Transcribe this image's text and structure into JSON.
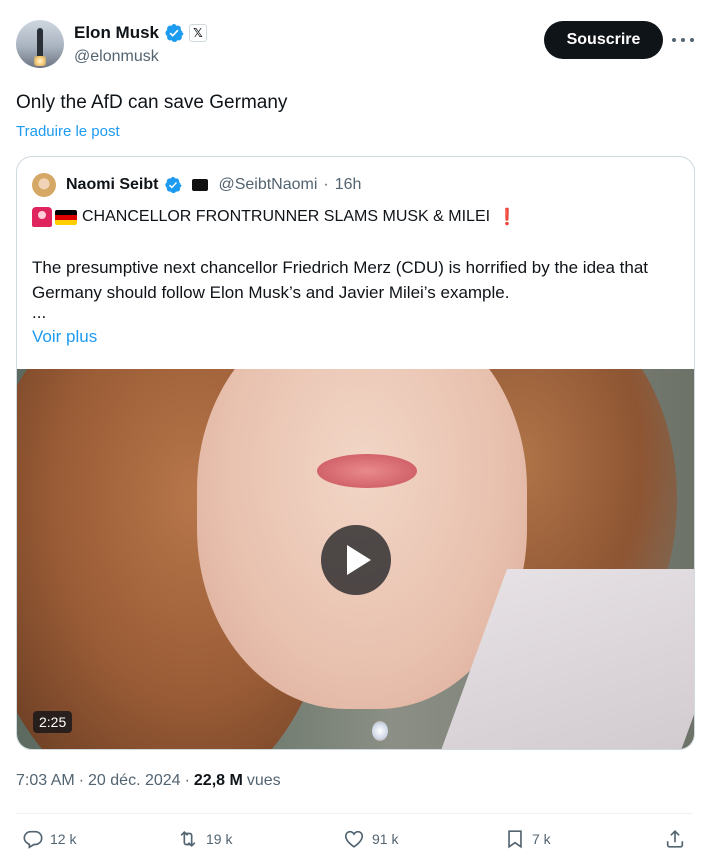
{
  "author": {
    "display_name": "Elon Musk",
    "handle": "@elonmusk",
    "affiliation_badge": "𝕏"
  },
  "header": {
    "subscribe_label": "Souscrire",
    "more_icon": "more-horizontal-icon"
  },
  "post": {
    "text": "Only the AfD can save Germany",
    "translate_label": "Traduire le post"
  },
  "quoted": {
    "display_name": "Naomi Seibt",
    "handle": "@SeibtNaomi",
    "separator": "·",
    "time": "16h",
    "headline": "CHANCELLOR FRONTRUNNER SLAMS MUSK & MILEI",
    "headline_suffix": "❗",
    "body": "The presumptive next chancellor Friedrich Merz (CDU) is horrified by the idea that Germany should follow Elon Musk’s and Javier Milei’s example.",
    "ellipsis": "...",
    "show_more_label": "Voir plus",
    "video_duration": "2:25"
  },
  "meta": {
    "time": "7:03 AM",
    "separator": "·",
    "date": "20 déc. 2024",
    "separator2": "·",
    "views_count": "22,8 M",
    "views_label": "vues"
  },
  "actions": {
    "replies": "12 k",
    "reposts": "19 k",
    "likes": "91 k",
    "bookmarks": "7 k"
  },
  "colors": {
    "accent": "#1d9bf0",
    "text": "#0f1419",
    "secondary": "#536471",
    "border": "#cfd9de",
    "button_bg": "#0f1419"
  }
}
